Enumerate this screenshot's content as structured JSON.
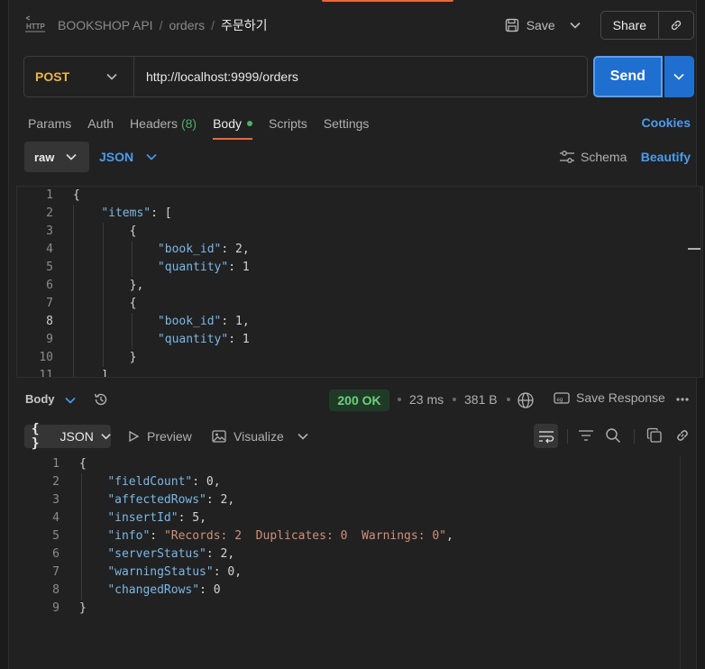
{
  "header": {
    "breadcrumb": [
      "BOOKSHOP API",
      "orders"
    ],
    "current": "주문하기",
    "save_label": "Save",
    "share_label": "Share"
  },
  "request": {
    "method": "POST",
    "url": "http://localhost:9999/orders",
    "send_label": "Send",
    "tabs": {
      "params": "Params",
      "auth": "Auth",
      "headers": "Headers",
      "headers_count": "(8)",
      "body": "Body",
      "scripts": "Scripts",
      "settings": "Settings"
    },
    "cookies_label": "Cookies",
    "body_mode": "raw",
    "body_format": "JSON",
    "schema_label": "Schema",
    "beautify_label": "Beautify",
    "code_lines": [
      {
        "n": "1",
        "text": "{"
      },
      {
        "n": "2",
        "text": "    \"items\": ["
      },
      {
        "n": "3",
        "text": "        {"
      },
      {
        "n": "4",
        "text": "            \"book_id\": 2,"
      },
      {
        "n": "5",
        "text": "            \"quantity\": 1"
      },
      {
        "n": "6",
        "text": "        },"
      },
      {
        "n": "7",
        "text": "        {"
      },
      {
        "n": "8",
        "text": "            \"book_id\": 1,"
      },
      {
        "n": "9",
        "text": "            \"quantity\": 1"
      },
      {
        "n": "10",
        "text": "        }"
      },
      {
        "n": "11",
        "text": "    ],"
      }
    ]
  },
  "response": {
    "body_label": "Body",
    "status": "200 OK",
    "time": "23 ms",
    "size": "381 B",
    "save_response_label": "Save Response",
    "format_label": "JSON",
    "preview_label": "Preview",
    "visualize_label": "Visualize",
    "code_lines": [
      {
        "n": "1",
        "text": "{"
      },
      {
        "n": "2",
        "text": "    \"fieldCount\": 0,"
      },
      {
        "n": "3",
        "text": "    \"affectedRows\": 2,"
      },
      {
        "n": "4",
        "text": "    \"insertId\": 5,"
      },
      {
        "n": "5",
        "text": "    \"info\": \"Records: 2  Duplicates: 0  Warnings: 0\","
      },
      {
        "n": "6",
        "text": "    \"serverStatus\": 2,"
      },
      {
        "n": "7",
        "text": "    \"warningStatus\": 0,"
      },
      {
        "n": "8",
        "text": "    \"changedRows\": 0"
      },
      {
        "n": "9",
        "text": "}"
      }
    ]
  },
  "colors": {
    "accent": "#e8673c",
    "send": "#1f6fd0",
    "link": "#4a9cf0",
    "method": "#e9b44c",
    "key": "#7ab8e8",
    "string": "#ce9178",
    "number": "#b5cea8",
    "status_ok": "#6fcf7f"
  },
  "icons": [
    "http-icon",
    "save-icon",
    "chevron-down-icon",
    "link-icon",
    "schema-icon",
    "history-icon",
    "globe-icon",
    "save-response-icon",
    "more-icon",
    "play-icon",
    "image-icon",
    "wrap-icon",
    "filter-icon",
    "search-icon",
    "copy-icon"
  ]
}
